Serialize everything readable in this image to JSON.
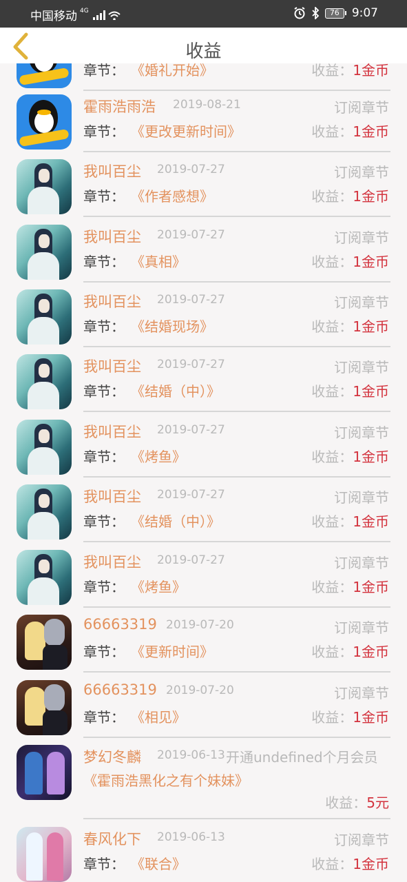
{
  "status_bar": {
    "carrier": "中国移动",
    "network": "4G",
    "battery": "76",
    "time": "9:07"
  },
  "header": {
    "title": "收益"
  },
  "labels": {
    "chapter": "章节：",
    "income": "收益："
  },
  "items": [
    {
      "name": "",
      "date": "",
      "type": "",
      "chapter": "《婚礼开始》",
      "income_label": "收益：",
      "income": "1金币",
      "avatar": "qq-penguin"
    },
    {
      "name": "霍雨浩雨浩",
      "date": "2019-08-21",
      "type": "订阅章节",
      "chapter": "《更改更新时间》",
      "income_label": "收益：",
      "income": "1金币",
      "avatar": "qq-penguin"
    },
    {
      "name": "我叫百尘",
      "date": "2019-07-27",
      "type": "订阅章节",
      "chapter": "《作者感想》",
      "income_label": "收益：",
      "income": "1金币",
      "avatar": "anime-teal"
    },
    {
      "name": "我叫百尘",
      "date": "2019-07-27",
      "type": "订阅章节",
      "chapter": "《真相》",
      "income_label": "收益：",
      "income": "1金币",
      "avatar": "anime-teal"
    },
    {
      "name": "我叫百尘",
      "date": "2019-07-27",
      "type": "订阅章节",
      "chapter": "《结婚现场》",
      "income_label": "收益：",
      "income": "1金币",
      "avatar": "anime-teal"
    },
    {
      "name": "我叫百尘",
      "date": "2019-07-27",
      "type": "订阅章节",
      "chapter": "《结婚（中）》",
      "income_label": "收益：",
      "income": "1金币",
      "avatar": "anime-teal"
    },
    {
      "name": "我叫百尘",
      "date": "2019-07-27",
      "type": "订阅章节",
      "chapter": "《烤鱼》",
      "income_label": "收益：",
      "income": "1金币",
      "avatar": "anime-teal"
    },
    {
      "name": "我叫百尘",
      "date": "2019-07-27",
      "type": "订阅章节",
      "chapter": "《结婚（中）》",
      "income_label": "收益：",
      "income": "1金币",
      "avatar": "anime-teal"
    },
    {
      "name": "我叫百尘",
      "date": "2019-07-27",
      "type": "订阅章节",
      "chapter": "《烤鱼》",
      "income_label": "收益：",
      "income": "1金币",
      "avatar": "anime-teal"
    },
    {
      "name": "66663319",
      "date": "2019-07-20",
      "type": "订阅章节",
      "chapter": "《更新时间》",
      "income_label": "收益：",
      "income": "1金币",
      "avatar": "anime-couple"
    },
    {
      "name": "66663319",
      "date": "2019-07-20",
      "type": "订阅章节",
      "chapter": "《相见》",
      "income_label": "收益：",
      "income": "1金币",
      "avatar": "anime-couple"
    },
    {
      "name": "梦幻冬麟",
      "date": "2019-06-13",
      "type": "开通undefined个月会员",
      "chapter": "《霍雨浩黑化之有个妹妹》",
      "income_label": "收益：",
      "income": "5元",
      "avatar": "anime-dark"
    },
    {
      "name": "春风化下",
      "date": "2019-06-13",
      "type": "订阅章节",
      "chapter": "《联合》",
      "income_label": "收益：",
      "income": "1金币",
      "avatar": "anime-pink"
    }
  ],
  "colors": {
    "name": "#e3925e",
    "income_value": "#d3323d",
    "muted": "#b9b9b9",
    "back_arrow": "#e0b23a"
  }
}
